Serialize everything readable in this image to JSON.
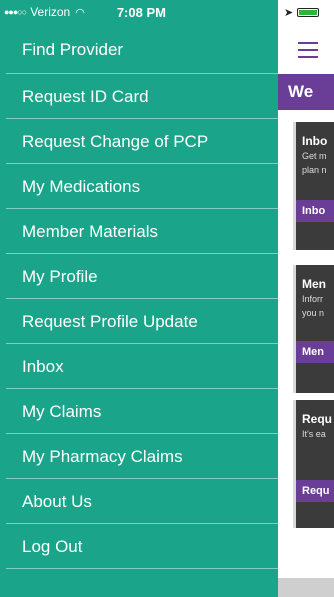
{
  "status_bar": {
    "carrier": "Verizon",
    "time": "7:08 PM"
  },
  "drawer": {
    "items": [
      {
        "label": "Find Provider"
      },
      {
        "label": "Request ID Card"
      },
      {
        "label": "Request Change of PCP"
      },
      {
        "label": "My Medications"
      },
      {
        "label": "Member Materials"
      },
      {
        "label": "My Profile"
      },
      {
        "label": "Request Profile Update"
      },
      {
        "label": "Inbox"
      },
      {
        "label": "My Claims"
      },
      {
        "label": "My Pharmacy Claims"
      },
      {
        "label": "About Us"
      },
      {
        "label": "Log Out"
      }
    ]
  },
  "background_page": {
    "welcome_partial": "We",
    "cards": [
      {
        "title_partial": "Inbo",
        "desc_partial_1": "Get m",
        "desc_partial_2": "plan n",
        "button_partial": "Inbo"
      },
      {
        "title_partial": "Men",
        "desc_partial_1": "Inforr",
        "desc_partial_2": "you n",
        "button_partial": "Men"
      },
      {
        "title_partial": "Requ",
        "desc_partial_1": "It's ea",
        "desc_partial_2": "",
        "button_partial": "Requ"
      }
    ]
  },
  "colors": {
    "drawer_bg": "#1aa48a",
    "brand_purple": "#6a3d97",
    "card_bg": "#3b3b3b"
  }
}
